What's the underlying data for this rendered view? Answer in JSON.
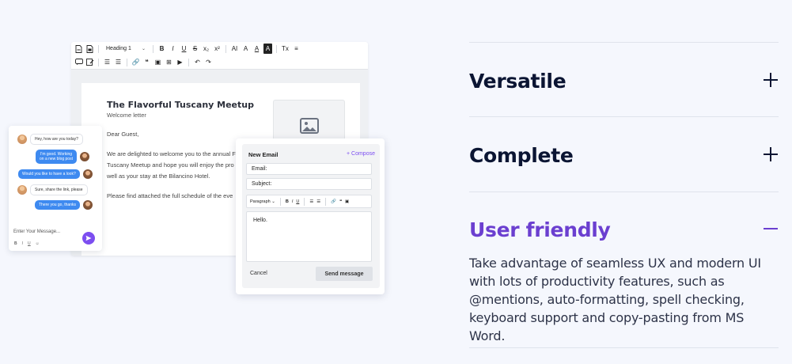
{
  "editor": {
    "toolbar": {
      "heading_select": "Heading 1",
      "row1_buttons": [
        "B",
        "I",
        "U",
        "S",
        "x₂",
        "x²",
        "AI",
        "A",
        "A",
        "A",
        "Tx",
        "≡"
      ],
      "row2_buttons": [
        "☰",
        "☰",
        "🔗",
        "❝",
        "▣",
        "⊞",
        "▶",
        "↶",
        "↷"
      ]
    },
    "document": {
      "title": "The Flavorful Tuscany Meetup",
      "subtitle": "Welcome letter",
      "greeting": "Dear Guest,",
      "paragraph_lines": [
        "We are delighted to welcome you to the annual F",
        "Tuscany Meetup and hope you will enjoy the pro",
        "well as your stay at the Bilancino Hotel."
      ],
      "paragraph2": "Please find attached the full schedule of the eve"
    }
  },
  "chat": {
    "messages": [
      {
        "side": "in",
        "text": "Hey, how are you today?"
      },
      {
        "side": "out",
        "text": "I'm good. Working on a new blog post"
      },
      {
        "side": "out",
        "text": "Would you like to have a look?"
      },
      {
        "side": "in",
        "text": "Sure, share the link, please"
      },
      {
        "side": "out",
        "text": "There you go, thanks"
      }
    ],
    "input_placeholder": "Enter Your Message...",
    "format_buttons": [
      "B",
      "I",
      "U",
      "☺"
    ]
  },
  "email": {
    "title": "New Email",
    "compose_label": "+ Compose",
    "email_label": "Email:",
    "subject_label": "Subject:",
    "paragraph_select": "Paragraph",
    "toolbar_buttons": [
      "B",
      "I",
      "U",
      "☰",
      "☰",
      "🔗",
      "❝",
      "▣"
    ],
    "body_text": "Hello.",
    "cancel_label": "Cancel",
    "send_label": "Send message"
  },
  "accordion": {
    "items": [
      {
        "title": "Versatile",
        "expanded": false
      },
      {
        "title": "Complete",
        "expanded": false
      },
      {
        "title": "User friendly",
        "expanded": true
      }
    ],
    "description": "Take advantage of seamless UX and modern UI with lots of productivity features, such as @mentions, auto-formatting, spell checking, keyboard support and copy-pasting from MS Word.",
    "colors": {
      "active": "#6b3fd0",
      "text": "#0b1533",
      "divider": "#dfe3ec"
    }
  }
}
